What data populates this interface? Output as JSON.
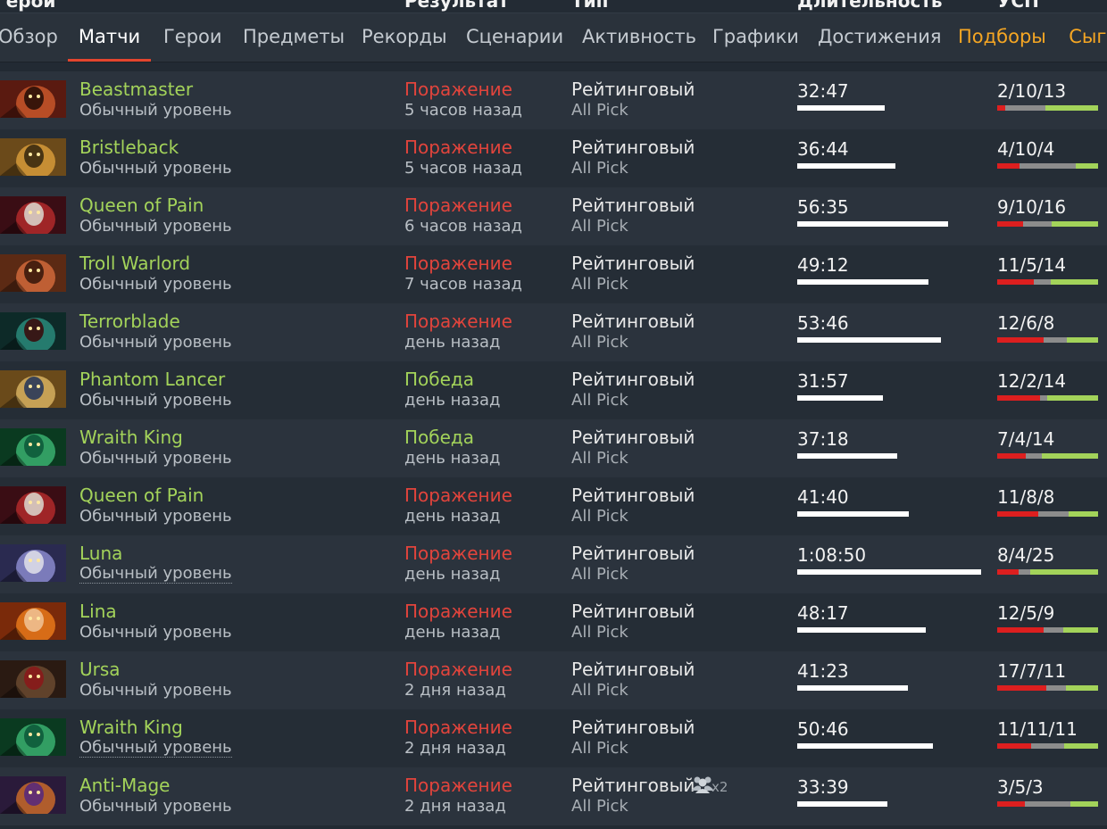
{
  "header": {
    "columns": [
      "Герой",
      "Результат",
      "Тип",
      "Длительность",
      "УСП"
    ]
  },
  "tabs": [
    {
      "label": "Обзор",
      "state": "normal"
    },
    {
      "label": "Матчи",
      "state": "active"
    },
    {
      "label": "Герои",
      "state": "normal"
    },
    {
      "label": "Предметы",
      "state": "normal"
    },
    {
      "label": "Рекорды",
      "state": "normal"
    },
    {
      "label": "Сценарии",
      "state": "normal"
    },
    {
      "label": "Активность",
      "state": "normal"
    },
    {
      "label": "Графики",
      "state": "normal"
    },
    {
      "label": "Достижения",
      "state": "normal"
    },
    {
      "label": "Подборы",
      "state": "highlight"
    },
    {
      "label": "Сыгр",
      "state": "highlight"
    }
  ],
  "colors": {
    "hero_name": "#a3d35a",
    "loss": "#e2443c",
    "win": "#a3d35a",
    "active_tab_underline": "#e3452e",
    "highlight_tab": "#f5a623"
  },
  "max_duration_seconds": 4130,
  "matches": [
    {
      "hero": "Beastmaster",
      "icon": "beastmaster-portrait",
      "level": "Обычный уровень",
      "result": "Поражение",
      "outcome": "loss",
      "when": "5 часов назад",
      "type": "Рейтинговый",
      "mode": "All Pick",
      "duration": "32:47",
      "duration_seconds": 1967,
      "kda": "2/10/13"
    },
    {
      "hero": "Bristleback",
      "icon": "bristleback-portrait",
      "level": "Обычный уровень",
      "result": "Поражение",
      "outcome": "loss",
      "when": "5 часов назад",
      "type": "Рейтинговый",
      "mode": "All Pick",
      "duration": "36:44",
      "duration_seconds": 2204,
      "kda": "4/10/4"
    },
    {
      "hero": "Queen of Pain",
      "icon": "queen-of-pain-portrait",
      "level": "Обычный уровень",
      "result": "Поражение",
      "outcome": "loss",
      "when": "6 часов назад",
      "type": "Рейтинговый",
      "mode": "All Pick",
      "duration": "56:35",
      "duration_seconds": 3395,
      "kda": "9/10/16"
    },
    {
      "hero": "Troll Warlord",
      "icon": "troll-warlord-portrait",
      "level": "Обычный уровень",
      "result": "Поражение",
      "outcome": "loss",
      "when": "7 часов назад",
      "type": "Рейтинговый",
      "mode": "All Pick",
      "duration": "49:12",
      "duration_seconds": 2952,
      "kda": "11/5/14"
    },
    {
      "hero": "Terrorblade",
      "icon": "terrorblade-portrait",
      "level": "Обычный уровень",
      "result": "Поражение",
      "outcome": "loss",
      "when": "день назад",
      "type": "Рейтинговый",
      "mode": "All Pick",
      "duration": "53:46",
      "duration_seconds": 3226,
      "kda": "12/6/8"
    },
    {
      "hero": "Phantom Lancer",
      "icon": "phantom-lancer-portrait",
      "level": "Обычный уровень",
      "result": "Победа",
      "outcome": "win",
      "when": "день назад",
      "type": "Рейтинговый",
      "mode": "All Pick",
      "duration": "31:57",
      "duration_seconds": 1917,
      "kda": "12/2/14"
    },
    {
      "hero": "Wraith King",
      "icon": "wraith-king-portrait",
      "level": "Обычный уровень",
      "result": "Победа",
      "outcome": "win",
      "when": "день назад",
      "type": "Рейтинговый",
      "mode": "All Pick",
      "duration": "37:18",
      "duration_seconds": 2238,
      "kda": "7/4/14"
    },
    {
      "hero": "Queen of Pain",
      "icon": "queen-of-pain-portrait",
      "level": "Обычный уровень",
      "result": "Поражение",
      "outcome": "loss",
      "when": "день назад",
      "type": "Рейтинговый",
      "mode": "All Pick",
      "duration": "41:40",
      "duration_seconds": 2500,
      "kda": "11/8/8"
    },
    {
      "hero": "Luna",
      "icon": "luna-portrait",
      "level": "Обычный уровень",
      "level_dotted": true,
      "result": "Поражение",
      "outcome": "loss",
      "when": "день назад",
      "type": "Рейтинговый",
      "mode": "All Pick",
      "duration": "1:08:50",
      "duration_seconds": 4130,
      "kda": "8/4/25"
    },
    {
      "hero": "Lina",
      "icon": "lina-portrait",
      "level": "Обычный уровень",
      "result": "Поражение",
      "outcome": "loss",
      "when": "день назад",
      "type": "Рейтинговый",
      "mode": "All Pick",
      "duration": "48:17",
      "duration_seconds": 2897,
      "kda": "12/5/9"
    },
    {
      "hero": "Ursa",
      "icon": "ursa-portrait",
      "level": "Обычный уровень",
      "result": "Поражение",
      "outcome": "loss",
      "when": "2 дня назад",
      "type": "Рейтинговый",
      "mode": "All Pick",
      "duration": "41:23",
      "duration_seconds": 2483,
      "kda": "17/7/11"
    },
    {
      "hero": "Wraith King",
      "icon": "wraith-king-portrait",
      "level": "Обычный уровень",
      "level_dotted": true,
      "result": "Поражение",
      "outcome": "loss",
      "when": "2 дня назад",
      "type": "Рейтинговый",
      "mode": "All Pick",
      "duration": "50:46",
      "duration_seconds": 3046,
      "kda": "11/11/11"
    },
    {
      "hero": "Anti-Mage",
      "icon": "anti-mage-portrait",
      "level": "Обычный уровень",
      "result": "Поражение",
      "outcome": "loss",
      "when": "2 дня назад",
      "type": "Рейтинговый",
      "mode": "All Pick",
      "party_icon": "party-group-icon",
      "party_size": "x2",
      "duration": "33:39",
      "duration_seconds": 2019,
      "kda": "3/5/3"
    }
  ]
}
